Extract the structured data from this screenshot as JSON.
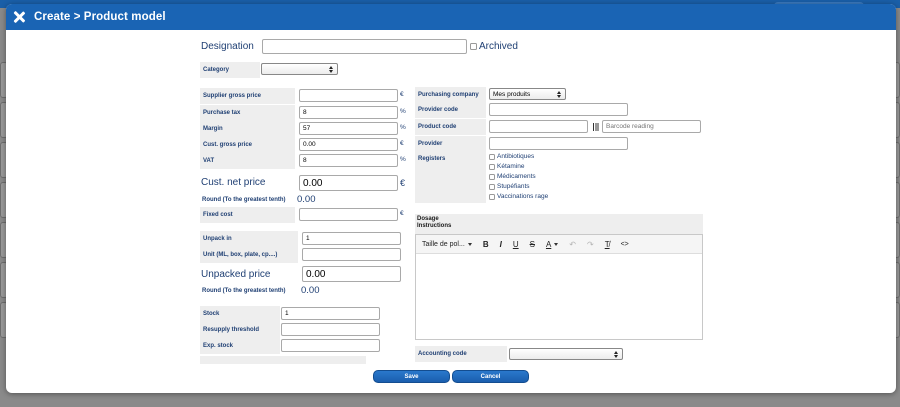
{
  "dialog": {
    "title": "Create > Product model"
  },
  "designation": {
    "label": "Designation",
    "value": "",
    "archived_label": "Archived"
  },
  "category": {
    "label": "Category",
    "selected": ""
  },
  "pricing": {
    "supplier_gross_price": {
      "label": "Supplier gross price",
      "value": "",
      "unit": "€"
    },
    "purchase_tax": {
      "label": "Purchase tax",
      "value": "8",
      "unit": "%"
    },
    "margin": {
      "label": "Margin",
      "value": "57",
      "unit": "%"
    },
    "cust_gross_price": {
      "label": "Cust. gross price",
      "value": "0.00",
      "unit": "€"
    },
    "vat": {
      "label": "VAT",
      "value": "8",
      "unit": "%"
    },
    "cust_net_price": {
      "label": "Cust. net price",
      "value": "0.00",
      "unit": "€"
    },
    "round1": {
      "label": "Round (To the greatest tenth)",
      "value": "0.00"
    },
    "fixed_cost": {
      "label": "Fixed cost",
      "value": "",
      "unit": "€"
    }
  },
  "unpack": {
    "unpack_in": {
      "label": "Unpack in",
      "value": "1"
    },
    "unit": {
      "label": "Unit (ML, box, plate, cp....)",
      "value": ""
    },
    "unpacked_price": {
      "label": "Unpacked price",
      "value": "0.00"
    },
    "round2": {
      "label": "Round (To the greatest tenth)",
      "value": "0.00"
    }
  },
  "stock": {
    "stock": {
      "label": "Stock",
      "value": "1"
    },
    "resupply_threshold": {
      "label": "Resupply threshold",
      "value": ""
    },
    "exp_stock": {
      "label": "Exp. stock",
      "value": ""
    }
  },
  "provider": {
    "purchasing_company": {
      "label": "Purchasing company",
      "selected": "Mes produits"
    },
    "provider_code": {
      "label": "Provider code",
      "value": ""
    },
    "product_code": {
      "label": "Product code",
      "value": "",
      "barcode_placeholder": "Barcode reading"
    },
    "provider": {
      "label": "Provider",
      "value": ""
    }
  },
  "registers": {
    "label": "Registers",
    "items": [
      "Antibiotiques",
      "Kétamine",
      "Médicaments",
      "Stupéfiants",
      "Vaccinations rage"
    ]
  },
  "dosage": {
    "label_line1": "Dosage",
    "label_line2": "Instructions",
    "toolbar": {
      "font_size": "Taille de pol...",
      "bold": "B",
      "italic": "I",
      "underline": "U",
      "strike": "S",
      "color": "A",
      "undo": "↶",
      "redo": "↷",
      "clear": "T̸",
      "code": "<>"
    }
  },
  "accounting": {
    "label": "Accounting code",
    "selected": ""
  },
  "actions": {
    "save": "Save",
    "cancel": "Cancel"
  },
  "colors": {
    "header": "#1a64b4",
    "label_text": "#1f3f73",
    "label_bg": "#eeeeee",
    "button": "#1a5eae"
  }
}
